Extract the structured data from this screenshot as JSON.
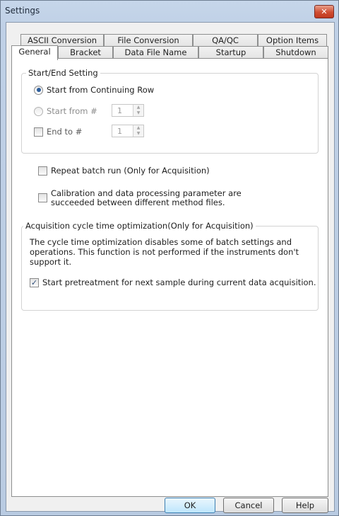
{
  "window": {
    "title": "Settings",
    "close_glyph": "✕"
  },
  "tabs_row1": [
    "ASCII Conversion",
    "File Conversion",
    "QA/QC",
    "Option Items"
  ],
  "tabs_row2": [
    "General",
    "Bracket",
    "Data File Name",
    "Startup",
    "Shutdown"
  ],
  "active_tab": "General",
  "start_end": {
    "legend": "Start/End Setting",
    "opt_continuing": "Start from Continuing Row",
    "opt_start_from": "Start from #",
    "start_value": "1",
    "end_to_label": "End to #",
    "end_value": "1"
  },
  "repeat_batch": {
    "label": "Repeat batch run (Only for Acquisition)",
    "checked": false
  },
  "calibration": {
    "line1": "Calibration and data processing parameter are",
    "line2": "succeeded between different method files.",
    "checked": false
  },
  "cycle": {
    "legend": "Acquisition cycle time optimization(Only for Acquisition)",
    "desc1": "The cycle time optimization disables some of batch settings and",
    "desc2": "operations. This function is not performed if the instruments don't",
    "desc3": "support it.",
    "pretreat_label": "Start pretreatment for next sample during current data acquisition.",
    "pretreat_checked": true
  },
  "buttons": {
    "ok": "OK",
    "cancel": "Cancel",
    "help": "Help"
  },
  "icons": {
    "close": "close-icon",
    "spin_up": "spin-up-icon",
    "spin_down": "spin-down-icon",
    "check": "check-icon"
  }
}
